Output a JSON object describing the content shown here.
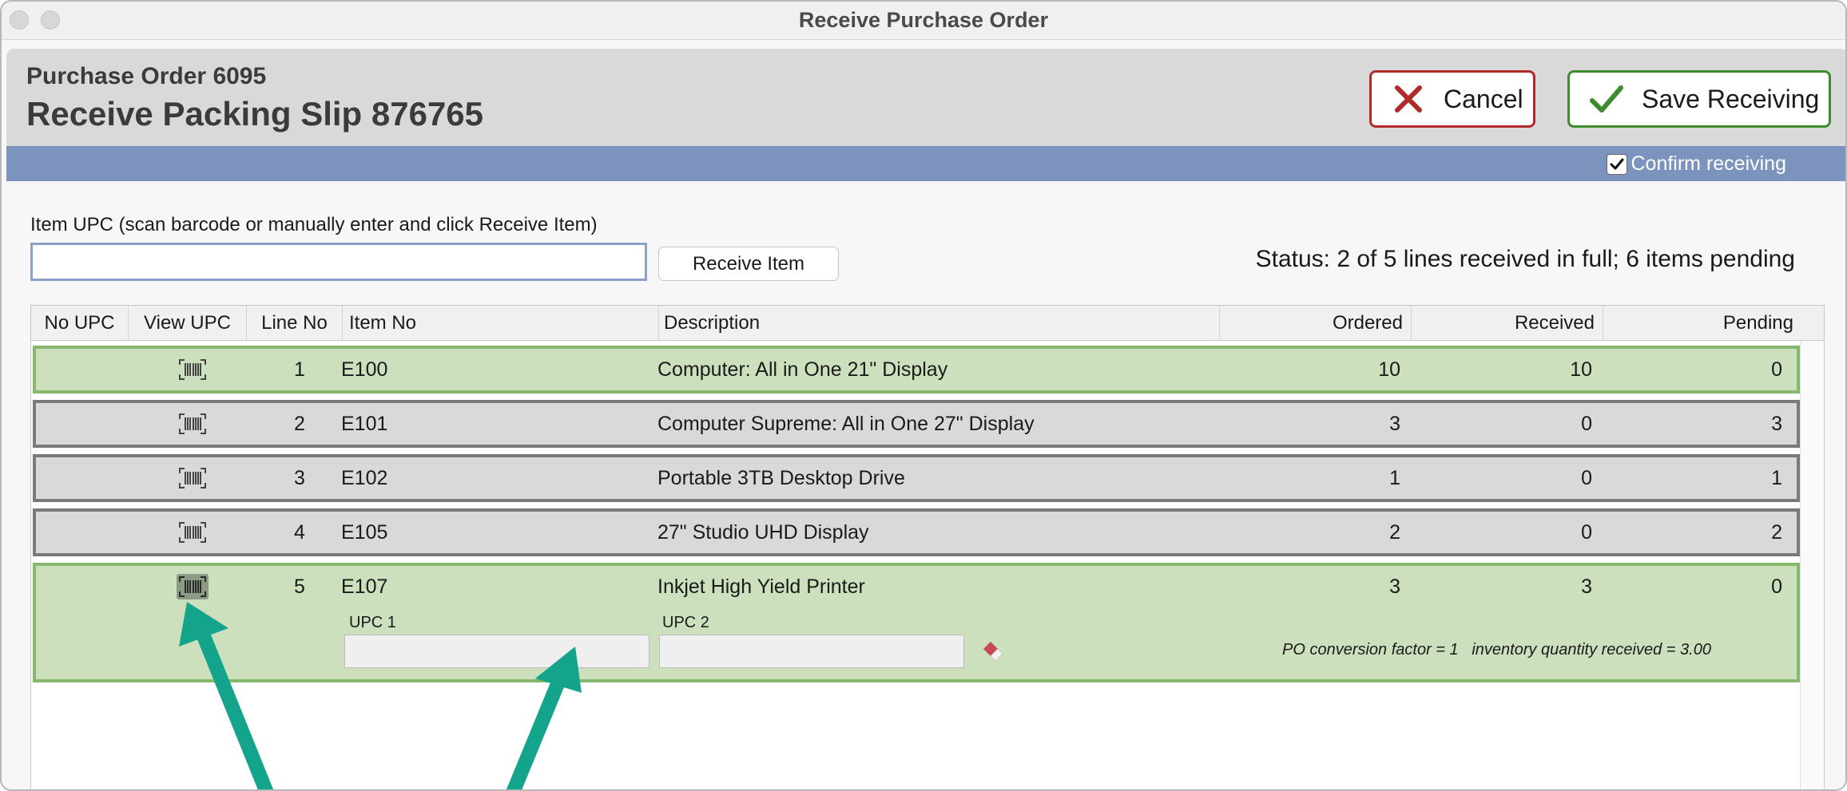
{
  "window": {
    "title": "Receive Purchase Order"
  },
  "header": {
    "po_number": "Purchase Order 6095",
    "slip_title": "Receive Packing Slip 876765",
    "cancel_label": "Cancel",
    "save_label": "Save Receiving"
  },
  "band": {
    "confirm_label": "Confirm receiving",
    "confirm_checked": true
  },
  "entry": {
    "label": "Item UPC (scan barcode or manually enter and click Receive Item)",
    "value": "",
    "button_label": "Receive Item",
    "status": "Status: 2 of 5 lines received in full; 6 items pending"
  },
  "table": {
    "columns": [
      "No UPC",
      "View UPC",
      "Line No",
      "Item No",
      "Description",
      "Ordered",
      "Received",
      "Pending"
    ],
    "rows": [
      {
        "line": "1",
        "item": "E100",
        "description": "Computer: All in One 21\" Display",
        "ordered": "10",
        "received": "10",
        "pending": "0",
        "state": "received"
      },
      {
        "line": "2",
        "item": "E101",
        "description": "Computer Supreme: All in One 27\" Display",
        "ordered": "3",
        "received": "0",
        "pending": "3",
        "state": "pending"
      },
      {
        "line": "3",
        "item": "E102",
        "description": "Portable 3TB Desktop Drive",
        "ordered": "1",
        "received": "0",
        "pending": "1",
        "state": "pending"
      },
      {
        "line": "4",
        "item": "E105",
        "description": "27\" Studio UHD Display",
        "ordered": "2",
        "received": "0",
        "pending": "2",
        "state": "pending"
      },
      {
        "line": "5",
        "item": "E107",
        "description": "Inkjet High Yield Printer",
        "ordered": "3",
        "received": "3",
        "pending": "0",
        "state": "received"
      }
    ],
    "expanded": {
      "upc1_label": "UPC 1",
      "upc1_value": "",
      "upc2_label": "UPC 2",
      "upc2_value": "",
      "note": "PO conversion factor = 1   inventory quantity received = 3.00"
    }
  },
  "icons": {
    "cancel": "x-icon",
    "save": "checkmark-icon",
    "view_upc": "barcode-icon",
    "clear_upc": "eraser-icon"
  },
  "colors": {
    "cancel_border": "#b02a2a",
    "save_border": "#3d8c2e",
    "band": "#7b93bd",
    "received_row": "#cde0bd",
    "received_border": "#86b86d",
    "pending_row": "#d9d9d9",
    "pending_border": "#7a7a7a",
    "annotation_arrow": "#14a38b"
  }
}
